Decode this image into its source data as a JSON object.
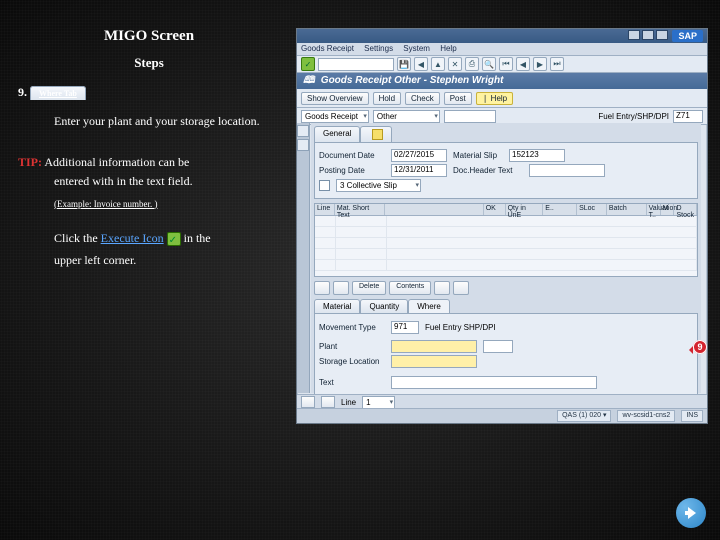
{
  "left": {
    "title": "MIGO Screen",
    "steps": "Steps",
    "step_number": "9.  ",
    "step_tab": "Where Tab",
    "step_body": "Enter your plant and your storage location.",
    "tip_label": "TIP:",
    "tip_line1": "  Additional information can be",
    "tip_line2": "entered with in the text field.",
    "tip_example": "(Example:  Invoice number. )",
    "exec_prefix": "Click the ",
    "exec_link": "Execute Icon",
    "exec_suffix": " in the",
    "exec_line2": "upper left corner.",
    "callout": "9"
  },
  "sap": {
    "logo": "SAP",
    "menu": [
      "Goods Receipt",
      "Settings",
      "System",
      "Help"
    ],
    "page_title": "Goods Receipt Other - Stephen Wright",
    "toolbar": [
      "Show Overview",
      "Hold",
      "Check",
      "Post",
      "❘ Help"
    ],
    "filter": {
      "action": "Goods Receipt",
      "ref": "Other",
      "fuel_label": "Fuel Entry/SHP/DPI",
      "mvt": "Z71"
    },
    "header_tabs": [
      "General"
    ],
    "header": {
      "docdate_l": "Document Date",
      "docdate": "02/27/2015",
      "matslip_l": "Material Slip",
      "matslip": "152123",
      "postdate_l": "Posting Date",
      "postdate": "12/31/2011",
      "headertext_l": "Doc.Header Text",
      "slip": "3 Collective Slip"
    },
    "grid": {
      "cols": [
        "Line",
        "Mat. Short Text",
        "",
        "OK",
        "Qty in UnE",
        "E..",
        "SLoc",
        "Batch",
        "Valuation T..",
        "M",
        "D  Stock"
      ]
    },
    "gridbar": [
      "Delete",
      "Contents"
    ],
    "detail_tabs": [
      "Material",
      "Quantity",
      "Where"
    ],
    "where": {
      "mvt_l": "Movement Type",
      "mvt": "971",
      "mvt_desc": "Fuel Entry SHP/DPI",
      "plant_l": "Plant",
      "sloc_l": "Storage Location",
      "text_l": "Text"
    },
    "status": {
      "line_l": "Line",
      "line": "1"
    },
    "sys": [
      "QAS (1) 020 ▾",
      "wv-scsid1-cns2",
      "INS"
    ]
  }
}
